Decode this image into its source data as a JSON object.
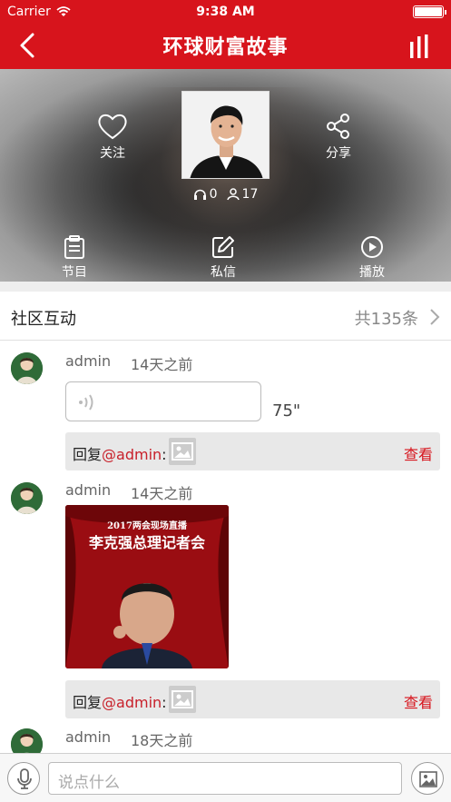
{
  "status_bar": {
    "carrier": "Carrier",
    "time": "9:38 AM"
  },
  "nav": {
    "title": "环球财富故事"
  },
  "hero": {
    "follow_label": "关注",
    "share_label": "分享",
    "listen_count": "0",
    "follower_count": "17",
    "programs_label": "节目",
    "message_label": "私信",
    "play_label": "播放"
  },
  "community": {
    "title": "社区互动",
    "count": "共135条"
  },
  "posts": [
    {
      "user": "admin",
      "time": "14天之前",
      "voice_duration": "75\"",
      "reply_prefix": "回复",
      "reply_mention": "@admin",
      "reply_colon": ":",
      "view_label": "查看"
    },
    {
      "user": "admin",
      "time": "14天之前",
      "image_title_small": "2017两会现场直播",
      "image_title_big": "李克强总理记者会",
      "reply_prefix": "回复",
      "reply_mention": "@admin",
      "reply_colon": ":",
      "view_label": "查看"
    },
    {
      "user": "admin",
      "time": "18天之前"
    }
  ],
  "composer": {
    "placeholder": "说点什么"
  },
  "colors": {
    "brand_red": "#d7141c",
    "mention_red": "#c8202a"
  }
}
